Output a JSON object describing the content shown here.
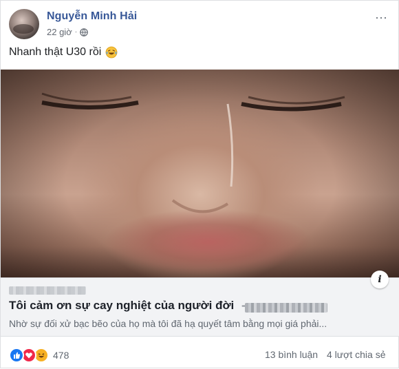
{
  "post": {
    "author": "Nguyễn Minh Hải",
    "time": "22 giờ",
    "separator": "·",
    "privacy_icon": "globe-icon",
    "more_label": "···",
    "status_text": "Nhanh thật U30 rồi",
    "status_emoji": "laughing-tears-emoji-icon"
  },
  "link_preview": {
    "info_label": "i",
    "title": "Tôi cảm ơn sự cay nghiệt của người đời",
    "title_separator": "-",
    "description": "Nhờ sự đối xử bạc bẽo của họ mà tôi đã hạ quyết tâm bằng mọi giá phải..."
  },
  "footer": {
    "reaction_icons": [
      "like-icon",
      "love-icon",
      "haha-icon"
    ],
    "reaction_count": "478",
    "comments": "13 bình luận",
    "shares": "4 lượt chia sẻ"
  },
  "colors": {
    "author_blue": "#385898",
    "like_blue": "#1877f2",
    "love_red": "#f0284a",
    "haha_yellow": "#f7b125"
  }
}
